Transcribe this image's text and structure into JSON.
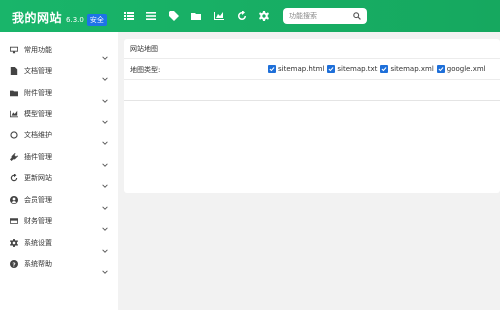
{
  "header": {
    "site_title": "我的网站",
    "version": "6.3.0",
    "badge": "安全",
    "toolbar_icons": [
      "list-icon",
      "menu-icon",
      "tag-icon",
      "folder-icon",
      "chart-icon",
      "refresh-icon",
      "gear-icon"
    ],
    "search_placeholder": "功能搜索"
  },
  "sidebar": {
    "items": [
      {
        "label": "常用功能",
        "icon": "monitor-icon"
      },
      {
        "label": "文档管理",
        "icon": "document-icon"
      },
      {
        "label": "附件管理",
        "icon": "folder-icon"
      },
      {
        "label": "模型管理",
        "icon": "chart-icon"
      },
      {
        "label": "文档维护",
        "icon": "circle-icon"
      },
      {
        "label": "插件管理",
        "icon": "plug-icon"
      },
      {
        "label": "更新网站",
        "icon": "refresh-icon"
      },
      {
        "label": "会员管理",
        "icon": "user-icon"
      },
      {
        "label": "财务管理",
        "icon": "card-icon"
      },
      {
        "label": "系统设置",
        "icon": "gear-icon"
      },
      {
        "label": "系统帮助",
        "icon": "help-icon"
      }
    ]
  },
  "main": {
    "panel_title": "网站地图",
    "map_type_label": "地图类型:",
    "options": [
      {
        "label": "sitemap.html",
        "checked": true
      },
      {
        "label": "sitemap.txt",
        "checked": true
      },
      {
        "label": "sitemap.xml",
        "checked": true
      },
      {
        "label": "google.xml",
        "checked": true
      }
    ]
  },
  "colors": {
    "header_green": "#19b56a",
    "badge_blue": "#1e73e8",
    "checkbox_blue": "#1e6fd9"
  }
}
